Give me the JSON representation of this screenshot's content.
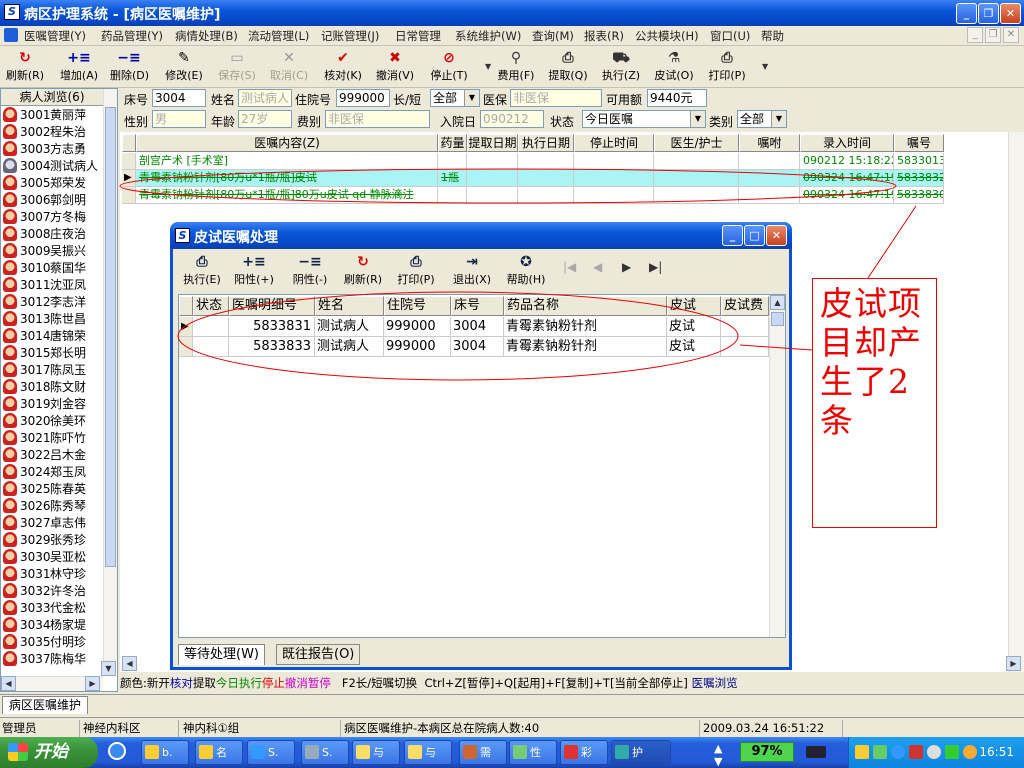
{
  "window": {
    "title": "病区护理系统 - [病区医嘱维护]"
  },
  "menu": [
    "医嘱管理(Y)",
    "药品管理(Y)",
    "病情处理(B)",
    "流动管理(L)",
    "记账管理(J)",
    "日常管理",
    "系统维护(W)",
    "查询(M)",
    "报表(R)",
    "公共模块(H)",
    "窗口(U)",
    "帮助"
  ],
  "toolbar": [
    {
      "label": "刷新(R)",
      "icon": "refresh-icon",
      "glyph": "↻",
      "color": "#d00",
      "enabled": true
    },
    {
      "label": "增加(A)",
      "icon": "add-icon",
      "glyph": "+≡",
      "color": "#00a",
      "enabled": true
    },
    {
      "label": "删除(D)",
      "icon": "delete-icon",
      "glyph": "−≡",
      "color": "#00a",
      "enabled": true
    },
    {
      "label": "修改(E)",
      "icon": "edit-icon",
      "glyph": "✎",
      "color": "#000",
      "enabled": true
    },
    {
      "label": "保存(S)",
      "icon": "save-icon",
      "glyph": "▭",
      "color": "#999",
      "enabled": false
    },
    {
      "label": "取消(C)",
      "icon": "cancel-icon",
      "glyph": "✕",
      "color": "#999",
      "enabled": false
    },
    {
      "label": "核对(K)",
      "icon": "check-icon",
      "glyph": "✔",
      "color": "#d00",
      "enabled": true
    },
    {
      "label": "撤消(V)",
      "icon": "undo-icon",
      "glyph": "✖",
      "color": "#c00",
      "enabled": true
    },
    {
      "label": "停止(T)",
      "icon": "stop-icon",
      "glyph": "⊘",
      "color": "#d00",
      "enabled": true
    },
    {
      "label": "费用(F)",
      "icon": "search-icon",
      "glyph": "⚲",
      "color": "#333",
      "enabled": true
    },
    {
      "label": "提取(Q)",
      "icon": "extract-icon",
      "glyph": "⎙",
      "color": "#333",
      "enabled": true
    },
    {
      "label": "执行(Z)",
      "icon": "execute-icon",
      "glyph": "⛟",
      "color": "#333",
      "enabled": true
    },
    {
      "label": "皮试(O)",
      "icon": "skintest-icon",
      "glyph": "⚗",
      "color": "#333",
      "enabled": true
    },
    {
      "label": "打印(P)",
      "icon": "print-icon",
      "glyph": "⎙",
      "color": "#333",
      "enabled": true
    }
  ],
  "patient_browser": {
    "title": "病人浏览(6)",
    "selected_bed": "3004",
    "patients": [
      {
        "bed": "3001",
        "name": "黄丽萍"
      },
      {
        "bed": "3002",
        "name": "程朱治"
      },
      {
        "bed": "3003",
        "name": "方志勇"
      },
      {
        "bed": "3004",
        "name": "测试病人"
      },
      {
        "bed": "3005",
        "name": "郑荣发"
      },
      {
        "bed": "3006",
        "name": "郭剑明"
      },
      {
        "bed": "3007",
        "name": "方冬梅"
      },
      {
        "bed": "3008",
        "name": "庄夜治"
      },
      {
        "bed": "3009",
        "name": "吴振兴"
      },
      {
        "bed": "3010",
        "name": "蔡国华"
      },
      {
        "bed": "3011",
        "name": "沈亚凤"
      },
      {
        "bed": "3012",
        "name": "李志洋"
      },
      {
        "bed": "3013",
        "name": "陈世昌"
      },
      {
        "bed": "3014",
        "name": "唐锦荣"
      },
      {
        "bed": "3015",
        "name": "郑长明"
      },
      {
        "bed": "3017",
        "name": "陈凤玉"
      },
      {
        "bed": "3018",
        "name": "陈文财"
      },
      {
        "bed": "3019",
        "name": "刘金容"
      },
      {
        "bed": "3020",
        "name": "徐美环"
      },
      {
        "bed": "3021",
        "name": "陈吓竹"
      },
      {
        "bed": "3022",
        "name": "吕木金"
      },
      {
        "bed": "3024",
        "name": "郑玉凤"
      },
      {
        "bed": "3025",
        "name": "陈春英"
      },
      {
        "bed": "3026",
        "name": "陈秀琴"
      },
      {
        "bed": "3027",
        "name": "卓志伟"
      },
      {
        "bed": "3029",
        "name": "张秀珍"
      },
      {
        "bed": "3030",
        "name": "吴亚松"
      },
      {
        "bed": "3031",
        "name": "林守珍"
      },
      {
        "bed": "3032",
        "name": "许冬治"
      },
      {
        "bed": "3033",
        "name": "代金松"
      },
      {
        "bed": "3034",
        "name": "杨家堤"
      },
      {
        "bed": "3035",
        "name": "付明珍"
      },
      {
        "bed": "3037",
        "name": "陈梅华"
      }
    ]
  },
  "form": {
    "bed_label": "床号",
    "bed": "3004",
    "name_label": "姓名",
    "name": "测试病人",
    "admission_label": "住院号",
    "admission": "999000",
    "term_label": "长/短",
    "term": "全部",
    "insurance_label": "医保",
    "insurance": "非医保",
    "available_label": "可用额",
    "available": "9440元",
    "sex_label": "性别",
    "sex": "男",
    "age_label": "年龄",
    "age": "27岁",
    "fee_label": "费别",
    "fee": "非医保",
    "admit_date_label": "入院日",
    "admit_date": "090212",
    "status_label": "状态",
    "status": "今日医嘱",
    "category_label": "类别",
    "category": "全部"
  },
  "order_grid": {
    "columns": [
      "医嘱内容(Z)",
      "药量",
      "提取日期",
      "执行日期",
      "停止时间",
      "医生/护士",
      "嘱咐",
      "录入时间",
      "嘱号"
    ],
    "rows": [
      {
        "content": "剖宫产术   [手术室]",
        "dose": "",
        "extract": "",
        "exec": "",
        "stop": "",
        "doctor": "",
        "note": "",
        "time": "090212 15:18:22",
        "no": "5833013",
        "struck": false,
        "selected": false
      },
      {
        "content": "青霉素钠粉针剂[80万u*1瓶/瓶]皮试",
        "dose": "1瓶",
        "extract": "",
        "exec": "",
        "stop": "",
        "doctor": "",
        "note": "",
        "time": "090324 16:47:19",
        "no": "5833832",
        "struck": true,
        "selected": true
      },
      {
        "content": "青霉素钠粉针剂[80万u*1瓶/瓶]80万u皮试 qd 静脉滴注",
        "dose": "",
        "extract": "",
        "exec": "",
        "stop": "",
        "doctor": "",
        "note": "",
        "time": "090324 16:47:19",
        "no": "5833830",
        "struck": true,
        "selected": false
      }
    ]
  },
  "color_legend": [
    {
      "text": "颜色:",
      "color": "#000"
    },
    {
      "text": "新开",
      "color": "#000"
    },
    {
      "text": "核对",
      "color": "#00a"
    },
    {
      "text": "提取",
      "color": "#000"
    },
    {
      "text": "今日执行",
      "color": "#080"
    },
    {
      "text": "停止",
      "color": "#d00"
    },
    {
      "text": "撤消",
      "color": "#c0c"
    },
    {
      "text": "暂停",
      "color": "#c0c"
    },
    {
      "text": "   F2长/短嘱切换  Ctrl+Z[暂停]+Q[起用]+F[复制]+T[当前全部停止] ",
      "color": "#000"
    },
    {
      "text": "医嘱浏览",
      "color": "#008"
    }
  ],
  "mdi_tab": "病区医嘱维护",
  "status_bar": [
    "管理员",
    "神经内科区",
    "神内科①组",
    "病区医嘱维护-本病区总在院病人数:40",
    "2009.03.24 16:51:22"
  ],
  "dialog": {
    "title": "皮试医嘱处理",
    "toolbar": [
      {
        "label": "执行(E)",
        "icon": "execute-icon",
        "glyph": "⎙"
      },
      {
        "label": "阳性(+)",
        "icon": "positive-icon",
        "glyph": "+≡"
      },
      {
        "label": "阴性(-)",
        "icon": "negative-icon",
        "glyph": "−≡"
      },
      {
        "label": "刷新(R)",
        "icon": "refresh-icon",
        "glyph": "↻"
      },
      {
        "label": "打印(P)",
        "icon": "print-icon",
        "glyph": "⎙"
      },
      {
        "label": "退出(X)",
        "icon": "exit-icon",
        "glyph": "⇥"
      },
      {
        "label": "帮助(H)",
        "icon": "help-icon",
        "glyph": "✪"
      }
    ],
    "nav": [
      "|◀",
      "◀",
      "▶",
      "▶|"
    ],
    "columns": [
      "状态",
      "医嘱明细号",
      "姓名",
      "住院号",
      "床号",
      "药品名称",
      "皮试",
      "皮试费"
    ],
    "rows": [
      {
        "status": "",
        "detail_no": "5833831",
        "name": "测试病人",
        "admission": "999000",
        "bed": "3004",
        "drug": "青霉素钠粉针剂",
        "test": "皮试",
        "fee": ""
      },
      {
        "status": "",
        "detail_no": "5833833",
        "name": "测试病人",
        "admission": "999000",
        "bed": "3004",
        "drug": "青霉素钠粉针剂",
        "test": "皮试",
        "fee": ""
      }
    ],
    "tabs": [
      "等待处理(W)",
      "既往报告(O)"
    ]
  },
  "annotation": {
    "text": "皮试项目却产生了2条",
    "color": "#e00"
  },
  "taskbar": {
    "start": "开始",
    "buttons": [
      "b.",
      "名",
      "S.",
      "S.",
      "与",
      "与",
      "需",
      "性",
      "彩",
      "护"
    ],
    "battery": "97%",
    "clock": "16:51"
  }
}
